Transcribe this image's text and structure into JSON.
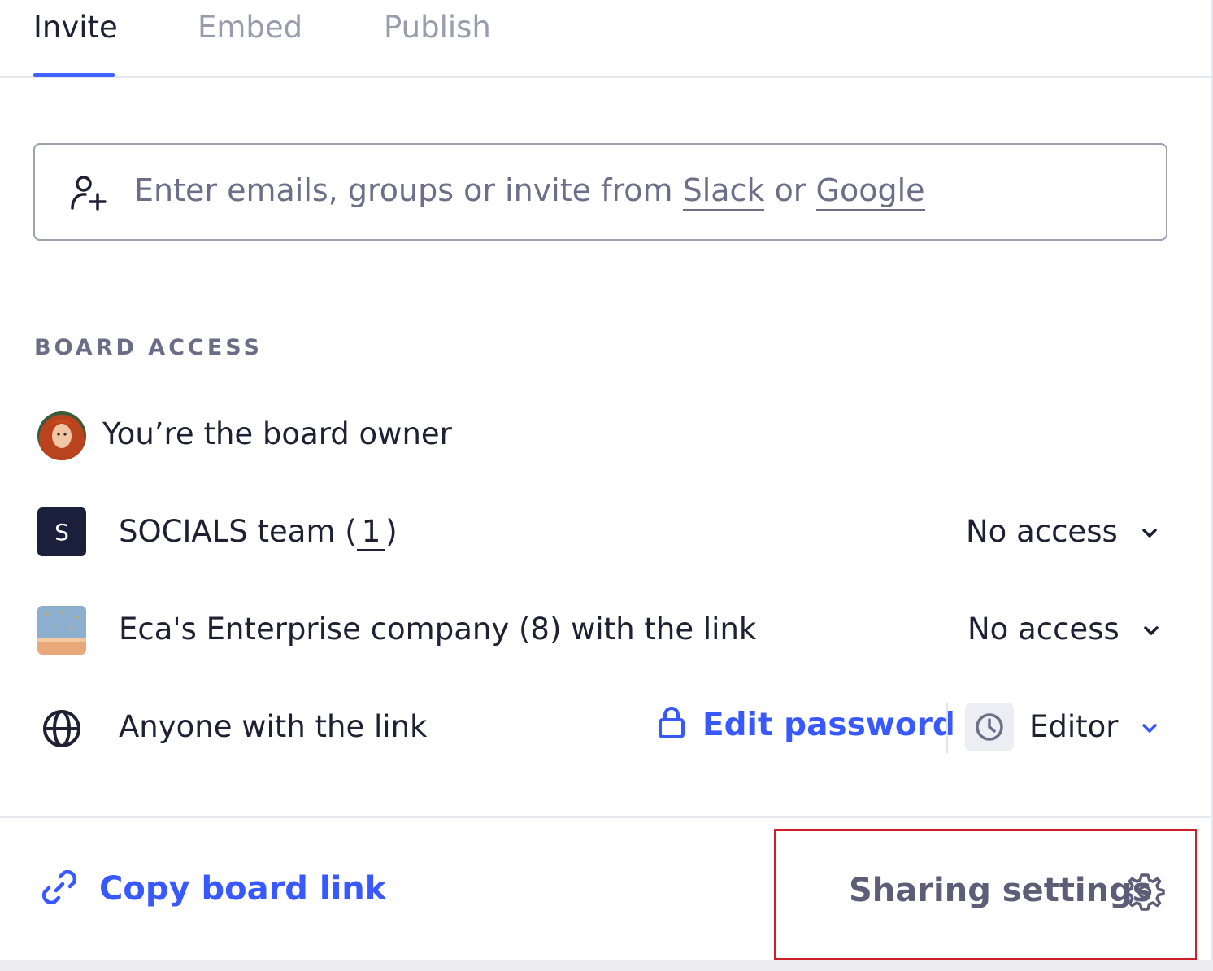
{
  "tabs": [
    {
      "label": "Invite",
      "active": true
    },
    {
      "label": "Embed",
      "active": false
    },
    {
      "label": "Publish",
      "active": false
    }
  ],
  "invite": {
    "placeholder_prefix": "Enter emails, groups or invite from",
    "slack": "Slack",
    "or": "or",
    "google": "Google",
    "icon": "add-user-icon"
  },
  "board_access": {
    "label": "BOARD ACCESS",
    "owner": {
      "text": "You’re the board owner"
    },
    "team": {
      "badge": "S",
      "name": "SOCIALS team (",
      "count": "1",
      "close": ")",
      "access": "No access"
    },
    "company": {
      "name": "Eca's Enterprise company (8) with the link",
      "access": "No access"
    },
    "anyone": {
      "text": "Anyone with the link",
      "edit_password": "Edit password",
      "access": "Editor",
      "icons": [
        "globe-icon",
        "lock-icon",
        "clock-icon"
      ]
    }
  },
  "footer": {
    "copy_link": "Copy board link",
    "sharing_settings": "Sharing settings"
  },
  "colors": {
    "accent": "#3859ff",
    "tab_underline": "#4262ff",
    "highlight_box": "#cc1f2a",
    "team_badge": "#1a1f3c"
  }
}
